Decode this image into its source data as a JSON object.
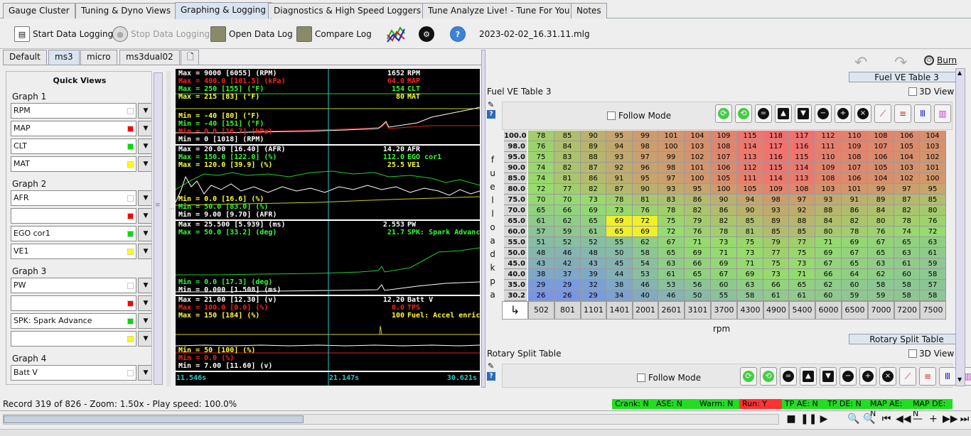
{
  "main_tabs": [
    "Gauge Cluster",
    "Tuning & Dyno Views",
    "Graphing & Logging",
    "Diagnostics & High Speed Loggers",
    "Tune Analyze Live! - Tune For You",
    "Notes"
  ],
  "toolbar": {
    "start_logging": "Start Data Logging",
    "stop_logging": "Stop Data Logging",
    "open_log": "Open Data Log",
    "compare_log": "Compare Log",
    "filename": "2023-02-02_16.31.11.mlg"
  },
  "sub_tabs": [
    "Default",
    "ms3",
    "micro",
    "ms3dual02"
  ],
  "quick_views": {
    "title": "Quick Views",
    "graphs": [
      {
        "title": "Graph 1",
        "items": [
          {
            "label": "RPM",
            "color": "#ffffff"
          },
          {
            "label": "MAP",
            "color": "#ff0000"
          },
          {
            "label": "CLT",
            "color": "#00dd00"
          },
          {
            "label": "MAT",
            "color": "#ffff00"
          }
        ]
      },
      {
        "title": "Graph 2",
        "items": [
          {
            "label": "AFR",
            "color": "#ffffff"
          },
          {
            "label": "",
            "color": "#ff0000"
          },
          {
            "label": "EGO cor1",
            "color": "#00dd00"
          },
          {
            "label": "VE1",
            "color": "#ffff00"
          }
        ]
      },
      {
        "title": "Graph 3",
        "items": [
          {
            "label": "PW",
            "color": "#ffffff"
          },
          {
            "label": "",
            "color": "#ff0000"
          },
          {
            "label": "SPK: Spark Advance",
            "color": "#00dd00"
          },
          {
            "label": "",
            "color": "#ffff00"
          }
        ]
      },
      {
        "title": "Graph 4",
        "items": [
          {
            "label": "Batt V",
            "color": "#ffffff"
          }
        ]
      }
    ]
  },
  "graph": {
    "p1": {
      "max": [
        [
          "Max = 9000 [6055] (RPM)",
          "#ffffff"
        ],
        [
          "Max = 400.0 [101.5] (kPa)",
          "#ff2020"
        ],
        [
          "Max = 250 [155] (°F)",
          "#33ff33"
        ],
        [
          "Max = 215 [83] (°F)",
          "#ffff33"
        ]
      ],
      "vals": [
        [
          "1652",
          "RPM",
          "#ffffff"
        ],
        [
          "64.0",
          "MAP",
          "#ff2020"
        ],
        [
          "154",
          "CLT",
          "#33ff33"
        ],
        [
          "80",
          "MAT",
          "#ffff33"
        ]
      ],
      "min": [
        [
          "Min = -40 [80] (°F)",
          "#ffff33"
        ],
        [
          "Min = -40 [151] (°F)",
          "#33ff33"
        ],
        [
          "Min = 0.0 [16.7] (kPa)",
          "#ff2020"
        ],
        [
          "Min = 0 [1018] (RPM)",
          "#ffffff"
        ]
      ]
    },
    "p2": {
      "max": [
        [
          "Max = 20.00 [16.40] (AFR)",
          "#ffffff"
        ],
        [
          "Max = 150.0 [122.0] (%)",
          "#33ff33"
        ],
        [
          "Max = 120.0 [39.9] (%)",
          "#ffff33"
        ]
      ],
      "vals": [
        [
          "14.20",
          "AFR",
          "#ffffff"
        ],
        [
          "112.0",
          "EGO cor1",
          "#33ff33"
        ],
        [
          "25.5",
          "VE1",
          "#ffff33"
        ]
      ],
      "min": [
        [
          "Min = 0.0 [16.6] (%)",
          "#ffff33"
        ],
        [
          "Min = 50.0 [83.0] (%)",
          "#33ff33"
        ],
        [
          "Min = 9.00 [9.70] (AFR)",
          "#ffffff"
        ]
      ]
    },
    "p3": {
      "max": [
        [
          "Max = 25.500 [5.939] (ms)",
          "#ffffff"
        ],
        [
          "Max = 50.0 [33.2] (deg)",
          "#33ff33"
        ]
      ],
      "vals": [
        [
          "2.553",
          "PW",
          "#ffffff"
        ],
        [
          "21.7",
          "SPK: Spark Advance",
          "#33ff33"
        ]
      ],
      "min": [
        [
          "Min = 0.0 [17.3] (deg)",
          "#33ff33"
        ],
        [
          "Min = 0.000 [1.508] (ms)",
          "#ffffff"
        ]
      ]
    },
    "p4": {
      "max": [
        [
          "Max = 21.00 [12.30] (v)",
          "#ffffff"
        ],
        [
          "Max = 100.0 [0.0] (%)",
          "#ff2020"
        ],
        [
          "Max = 150 [184] (%)",
          "#ffff33"
        ]
      ],
      "vals": [
        [
          "12.20",
          "Batt V",
          "#ffffff"
        ],
        [
          "0.0",
          "TPS",
          "#ff2020"
        ],
        [
          "100",
          "Fuel: Accel enrich",
          "#ffff33"
        ]
      ],
      "min": [
        [
          "Min = 50 [100] (%)",
          "#ffff33"
        ],
        [
          "Min = 0.0 (%)",
          "#ff2020"
        ],
        [
          "Min = 7.00 [11.60] (v)",
          "#ffffff"
        ]
      ]
    },
    "time_left": "11.546s",
    "time_center": "21.147s",
    "time_right": "30.621s"
  },
  "ve_table": {
    "tab_label": "Fuel VE Table 3",
    "title": "Fuel VE Table 3",
    "view3d": "3D View",
    "follow_mode": "Follow Mode",
    "burn": "Burn",
    "yaxis": "fuel load kpa",
    "xaxis": "rpm",
    "rows": [
      "100.0",
      "98.0",
      "95.0",
      "90.0",
      "85.0",
      "80.0",
      "75.0",
      "70.0",
      "65.0",
      "60.0",
      "55.0",
      "50.0",
      "45.0",
      "40.0",
      "35.0",
      "30.2"
    ],
    "cols": [
      "502",
      "801",
      "1101",
      "1401",
      "2001",
      "2601",
      "3101",
      "3700",
      "4300",
      "4900",
      "5400",
      "6000",
      "6500",
      "7000",
      "7200",
      "7500"
    ],
    "values": [
      [
        78,
        85,
        90,
        95,
        99,
        101,
        104,
        109,
        115,
        118,
        117,
        112,
        110,
        108,
        106,
        104
      ],
      [
        76,
        84,
        89,
        94,
        98,
        100,
        103,
        108,
        114,
        117,
        116,
        111,
        109,
        107,
        105,
        103
      ],
      [
        75,
        83,
        88,
        93,
        97,
        99,
        102,
        107,
        113,
        116,
        115,
        110,
        108,
        106,
        104,
        102
      ],
      [
        74,
        82,
        87,
        92,
        96,
        98,
        101,
        106,
        112,
        115,
        114,
        109,
        107,
        105,
        103,
        101
      ],
      [
        74,
        81,
        86,
        91,
        95,
        97,
        100,
        105,
        111,
        114,
        113,
        108,
        106,
        104,
        102,
        100
      ],
      [
        72,
        77,
        82,
        87,
        90,
        93,
        95,
        100,
        105,
        109,
        108,
        103,
        101,
        99,
        97,
        95
      ],
      [
        70,
        70,
        73,
        78,
        81,
        83,
        86,
        90,
        94,
        98,
        97,
        93,
        91,
        89,
        87,
        85
      ],
      [
        65,
        66,
        69,
        73,
        76,
        78,
        82,
        86,
        90,
        93,
        92,
        88,
        86,
        84,
        82,
        80
      ],
      [
        61,
        62,
        65,
        69,
        72,
        75,
        79,
        82,
        85,
        89,
        88,
        84,
        82,
        80,
        78,
        76
      ],
      [
        57,
        59,
        61,
        65,
        69,
        72,
        76,
        78,
        81,
        85,
        85,
        80,
        78,
        76,
        74,
        72
      ],
      [
        51,
        52,
        52,
        55,
        62,
        67,
        71,
        73,
        75,
        79,
        77,
        71,
        69,
        67,
        65,
        63
      ],
      [
        48,
        46,
        48,
        50,
        58,
        65,
        69,
        71,
        73,
        77,
        75,
        69,
        67,
        65,
        63,
        61
      ],
      [
        43,
        42,
        43,
        45,
        54,
        63,
        66,
        69,
        71,
        75,
        73,
        67,
        65,
        63,
        61,
        59
      ],
      [
        38,
        37,
        39,
        44,
        53,
        61,
        65,
        67,
        69,
        73,
        71,
        66,
        64,
        62,
        60,
        58
      ],
      [
        29,
        29,
        32,
        38,
        46,
        53,
        56,
        60,
        63,
        66,
        65,
        62,
        60,
        58,
        58,
        57
      ],
      [
        26,
        26,
        29,
        34,
        40,
        46,
        50,
        55,
        58,
        61,
        61,
        60,
        59,
        59,
        58,
        58
      ]
    ],
    "highlight": [
      [
        8,
        3
      ],
      [
        8,
        4
      ],
      [
        9,
        3
      ],
      [
        9,
        4
      ]
    ]
  },
  "rotary": {
    "tab_label": "Rotary Split Table",
    "title": "Rotary Split Table",
    "view3d": "3D View",
    "follow_mode": "Follow Mode"
  },
  "status": {
    "record": "Record 319 of 826 - Zoom: 1.50x - Play speed: 100.0%",
    "indicators": [
      [
        "Crank: N",
        "#22dd22"
      ],
      [
        "ASE: N",
        "#22dd22"
      ],
      [
        "Warm: N",
        "#22dd22"
      ],
      [
        "Run: Y",
        "#ff3333"
      ],
      [
        "TP AE: N",
        "#22dd22"
      ],
      [
        "TP DE: N",
        "#22dd22"
      ],
      [
        "MAP AE: N",
        "#22dd22"
      ],
      [
        "MAP DE: N",
        "#22dd22"
      ]
    ]
  }
}
